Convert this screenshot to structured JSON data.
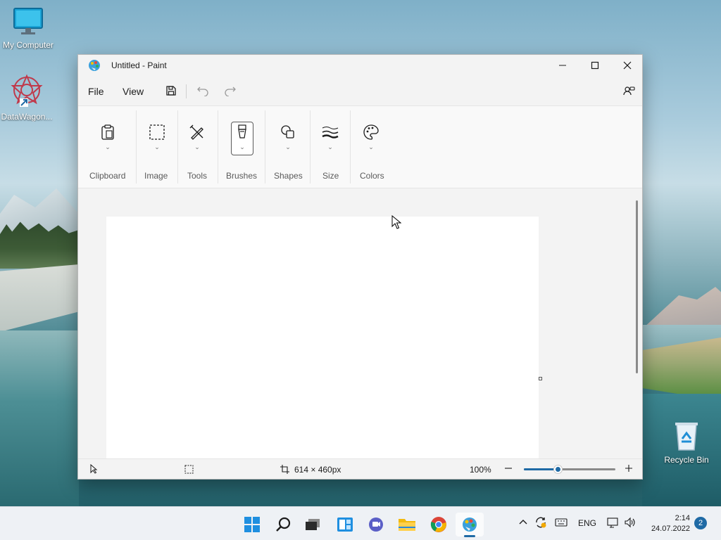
{
  "desktop": {
    "icons": [
      {
        "label": "My Computer",
        "icon": "monitor-icon"
      },
      {
        "label": "DataWagon...",
        "icon": "datawagon-icon"
      },
      {
        "label": "Recycle Bin",
        "icon": "recycle-bin-icon"
      }
    ]
  },
  "window": {
    "title": "Untitled - Paint",
    "app_icon": "paint-palette-icon"
  },
  "menu": {
    "file": "File",
    "view": "View"
  },
  "toolbar": {
    "groups": [
      {
        "label": "Clipboard",
        "icon": "clipboard-icon"
      },
      {
        "label": "Image",
        "icon": "selection-icon"
      },
      {
        "label": "Tools",
        "icon": "tools-icon"
      },
      {
        "label": "Brushes",
        "icon": "brush-icon"
      },
      {
        "label": "Shapes",
        "icon": "shapes-icon"
      },
      {
        "label": "Size",
        "icon": "size-lines-icon"
      },
      {
        "label": "Colors",
        "icon": "colors-palette-icon"
      }
    ]
  },
  "status": {
    "canvas_size": "614 × 460px",
    "zoom": "100%",
    "zoom_fraction": 0.38
  },
  "taskbar": {
    "apps": [
      "start-icon",
      "search-icon",
      "task-view-icon",
      "widgets-icon",
      "chat-icon",
      "file-explorer-icon",
      "chrome-icon",
      "paint-icon"
    ],
    "tray": {
      "language": "ENG",
      "time": "2:14",
      "date": "24.07.2022",
      "notifications": "2"
    }
  },
  "colors": {
    "accent": "#1f6aa5",
    "window_bg": "#f3f3f3",
    "canvas": "#ffffff"
  }
}
